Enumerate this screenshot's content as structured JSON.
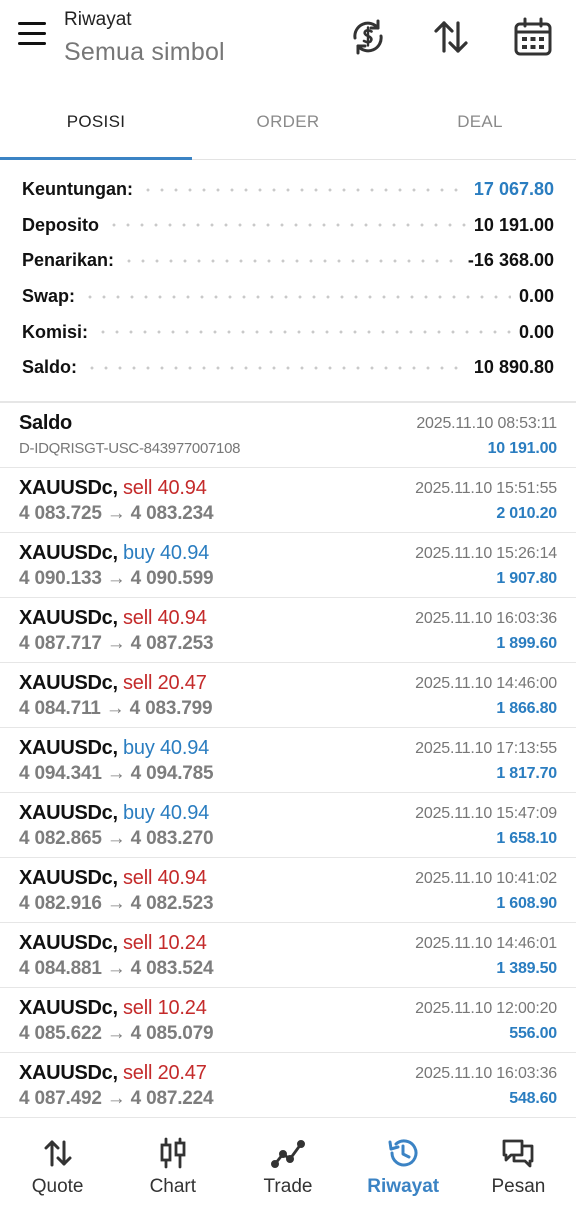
{
  "header": {
    "title": "Riwayat",
    "subtitle": "Semua simbol",
    "icons": [
      "currency-exchange-icon",
      "sort-icon",
      "calendar-icon"
    ]
  },
  "tabs": [
    {
      "label": "POSISI",
      "active": true
    },
    {
      "label": "ORDER",
      "active": false
    },
    {
      "label": "DEAL",
      "active": false
    }
  ],
  "summary": [
    {
      "label": "Keuntungan:",
      "value": "17 067.80",
      "color": "#2a7dc0"
    },
    {
      "label": "Deposito",
      "value": "10 191.00"
    },
    {
      "label": "Penarikan:",
      "value": "-16 368.00"
    },
    {
      "label": "Swap:",
      "value": "0.00"
    },
    {
      "label": "Komisi:",
      "value": "0.00"
    },
    {
      "label": "Saldo:",
      "value": "10 890.80"
    }
  ],
  "balance_entry": {
    "title": "Saldo",
    "comment": "D-IDQRISGT-USC-843977007108",
    "time": "2025.11.10 08:53:11",
    "amount": "10 191.00"
  },
  "deals": [
    {
      "symbol": "XAUUSDc,",
      "side": "sell 40.94",
      "type": "sell",
      "prices": "4 083.725 → 4 083.234",
      "time": "2025.11.10 15:51:55",
      "profit": "2 010.20"
    },
    {
      "symbol": "XAUUSDc,",
      "side": "buy 40.94",
      "type": "buy",
      "prices": "4 090.133 → 4 090.599",
      "time": "2025.11.10 15:26:14",
      "profit": "1 907.80"
    },
    {
      "symbol": "XAUUSDc,",
      "side": "sell 40.94",
      "type": "sell",
      "prices": "4 087.717 → 4 087.253",
      "time": "2025.11.10 16:03:36",
      "profit": "1 899.60"
    },
    {
      "symbol": "XAUUSDc,",
      "side": "sell 20.47",
      "type": "sell",
      "prices": "4 084.711 → 4 083.799",
      "time": "2025.11.10 14:46:00",
      "profit": "1 866.80"
    },
    {
      "symbol": "XAUUSDc,",
      "side": "buy 40.94",
      "type": "buy",
      "prices": "4 094.341 → 4 094.785",
      "time": "2025.11.10 17:13:55",
      "profit": "1 817.70"
    },
    {
      "symbol": "XAUUSDc,",
      "side": "buy 40.94",
      "type": "buy",
      "prices": "4 082.865 → 4 083.270",
      "time": "2025.11.10 15:47:09",
      "profit": "1 658.10"
    },
    {
      "symbol": "XAUUSDc,",
      "side": "sell 40.94",
      "type": "sell",
      "prices": "4 082.916 → 4 082.523",
      "time": "2025.11.10 10:41:02",
      "profit": "1 608.90"
    },
    {
      "symbol": "XAUUSDc,",
      "side": "sell 10.24",
      "type": "sell",
      "prices": "4 084.881 → 4 083.524",
      "time": "2025.11.10 14:46:01",
      "profit": "1 389.50"
    },
    {
      "symbol": "XAUUSDc,",
      "side": "sell 10.24",
      "type": "sell",
      "prices": "4 085.622 → 4 085.079",
      "time": "2025.11.10 12:00:20",
      "profit": "556.00"
    },
    {
      "symbol": "XAUUSDc,",
      "side": "sell 20.47",
      "type": "sell",
      "prices": "4 087.492 → 4 087.224",
      "time": "2025.11.10 16:03:36",
      "profit": "548.60"
    }
  ],
  "bottom_nav": [
    {
      "label": "Quote",
      "icon": "quote-arrows-icon",
      "active": false
    },
    {
      "label": "Chart",
      "icon": "candlestick-chart-icon",
      "active": false
    },
    {
      "label": "Trade",
      "icon": "trade-line-icon",
      "active": false
    },
    {
      "label": "Riwayat",
      "icon": "history-icon",
      "active": true
    },
    {
      "label": "Pesan",
      "icon": "messages-icon",
      "active": false
    }
  ],
  "colors": {
    "accent": "#3b83c4",
    "profit": "#2a7dc0",
    "sell": "#c42a2a",
    "buy": "#2a7dc0"
  }
}
